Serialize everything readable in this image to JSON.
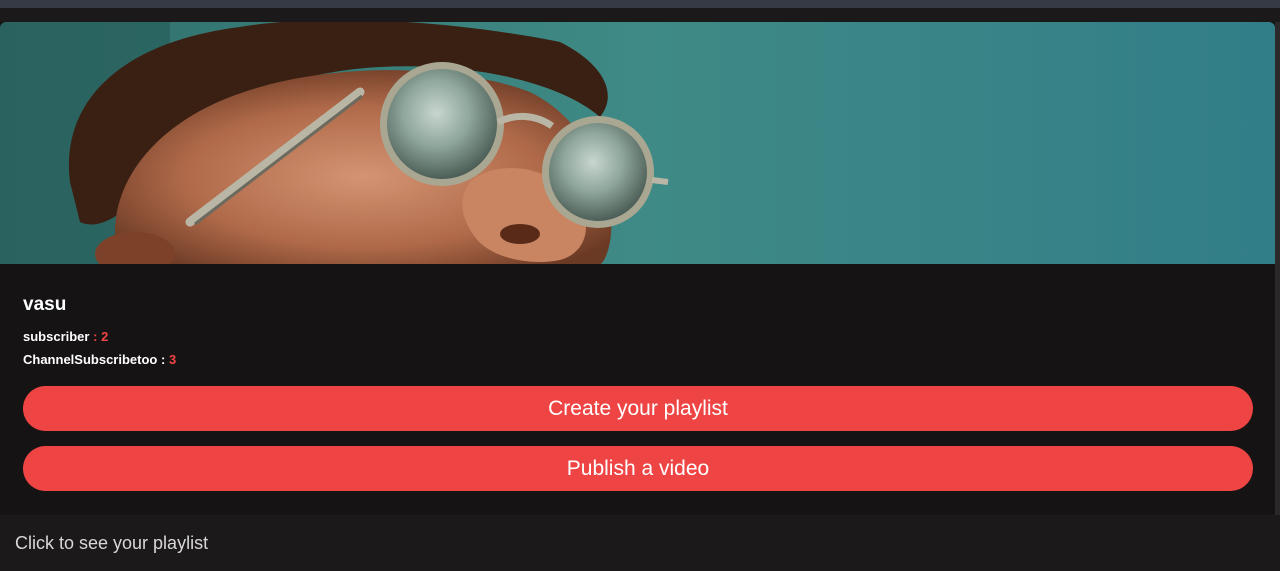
{
  "channel": {
    "name": "vasu",
    "subscriber_label": "subscriber",
    "subscriber_sep": ":",
    "subscriber_count": "2",
    "subscribed_to_label": "ChannelSubscribetoo",
    "subscribed_to_sep": ":",
    "subscribed_to_count": "3"
  },
  "actions": {
    "create_playlist_label": "Create your playlist",
    "publish_video_label": "Publish a video"
  },
  "links": {
    "see_playlist_label": "Click to see your playlist"
  },
  "colors": {
    "accent": "#ef4444",
    "background": "#141212",
    "banner_sky": "#3f8a86"
  }
}
